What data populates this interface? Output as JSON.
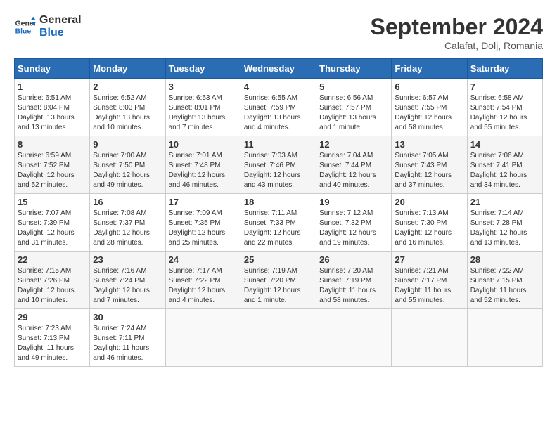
{
  "header": {
    "logo_line1": "General",
    "logo_line2": "Blue",
    "month_title": "September 2024",
    "subtitle": "Calafat, Dolj, Romania"
  },
  "weekdays": [
    "Sunday",
    "Monday",
    "Tuesday",
    "Wednesday",
    "Thursday",
    "Friday",
    "Saturday"
  ],
  "weeks": [
    [
      {
        "day": "1",
        "info": "Sunrise: 6:51 AM\nSunset: 8:04 PM\nDaylight: 13 hours\nand 13 minutes."
      },
      {
        "day": "2",
        "info": "Sunrise: 6:52 AM\nSunset: 8:03 PM\nDaylight: 13 hours\nand 10 minutes."
      },
      {
        "day": "3",
        "info": "Sunrise: 6:53 AM\nSunset: 8:01 PM\nDaylight: 13 hours\nand 7 minutes."
      },
      {
        "day": "4",
        "info": "Sunrise: 6:55 AM\nSunset: 7:59 PM\nDaylight: 13 hours\nand 4 minutes."
      },
      {
        "day": "5",
        "info": "Sunrise: 6:56 AM\nSunset: 7:57 PM\nDaylight: 13 hours\nand 1 minute."
      },
      {
        "day": "6",
        "info": "Sunrise: 6:57 AM\nSunset: 7:55 PM\nDaylight: 12 hours\nand 58 minutes."
      },
      {
        "day": "7",
        "info": "Sunrise: 6:58 AM\nSunset: 7:54 PM\nDaylight: 12 hours\nand 55 minutes."
      }
    ],
    [
      {
        "day": "8",
        "info": "Sunrise: 6:59 AM\nSunset: 7:52 PM\nDaylight: 12 hours\nand 52 minutes."
      },
      {
        "day": "9",
        "info": "Sunrise: 7:00 AM\nSunset: 7:50 PM\nDaylight: 12 hours\nand 49 minutes."
      },
      {
        "day": "10",
        "info": "Sunrise: 7:01 AM\nSunset: 7:48 PM\nDaylight: 12 hours\nand 46 minutes."
      },
      {
        "day": "11",
        "info": "Sunrise: 7:03 AM\nSunset: 7:46 PM\nDaylight: 12 hours\nand 43 minutes."
      },
      {
        "day": "12",
        "info": "Sunrise: 7:04 AM\nSunset: 7:44 PM\nDaylight: 12 hours\nand 40 minutes."
      },
      {
        "day": "13",
        "info": "Sunrise: 7:05 AM\nSunset: 7:43 PM\nDaylight: 12 hours\nand 37 minutes."
      },
      {
        "day": "14",
        "info": "Sunrise: 7:06 AM\nSunset: 7:41 PM\nDaylight: 12 hours\nand 34 minutes."
      }
    ],
    [
      {
        "day": "15",
        "info": "Sunrise: 7:07 AM\nSunset: 7:39 PM\nDaylight: 12 hours\nand 31 minutes."
      },
      {
        "day": "16",
        "info": "Sunrise: 7:08 AM\nSunset: 7:37 PM\nDaylight: 12 hours\nand 28 minutes."
      },
      {
        "day": "17",
        "info": "Sunrise: 7:09 AM\nSunset: 7:35 PM\nDaylight: 12 hours\nand 25 minutes."
      },
      {
        "day": "18",
        "info": "Sunrise: 7:11 AM\nSunset: 7:33 PM\nDaylight: 12 hours\nand 22 minutes."
      },
      {
        "day": "19",
        "info": "Sunrise: 7:12 AM\nSunset: 7:32 PM\nDaylight: 12 hours\nand 19 minutes."
      },
      {
        "day": "20",
        "info": "Sunrise: 7:13 AM\nSunset: 7:30 PM\nDaylight: 12 hours\nand 16 minutes."
      },
      {
        "day": "21",
        "info": "Sunrise: 7:14 AM\nSunset: 7:28 PM\nDaylight: 12 hours\nand 13 minutes."
      }
    ],
    [
      {
        "day": "22",
        "info": "Sunrise: 7:15 AM\nSunset: 7:26 PM\nDaylight: 12 hours\nand 10 minutes."
      },
      {
        "day": "23",
        "info": "Sunrise: 7:16 AM\nSunset: 7:24 PM\nDaylight: 12 hours\nand 7 minutes."
      },
      {
        "day": "24",
        "info": "Sunrise: 7:17 AM\nSunset: 7:22 PM\nDaylight: 12 hours\nand 4 minutes."
      },
      {
        "day": "25",
        "info": "Sunrise: 7:19 AM\nSunset: 7:20 PM\nDaylight: 12 hours\nand 1 minute."
      },
      {
        "day": "26",
        "info": "Sunrise: 7:20 AM\nSunset: 7:19 PM\nDaylight: 11 hours\nand 58 minutes."
      },
      {
        "day": "27",
        "info": "Sunrise: 7:21 AM\nSunset: 7:17 PM\nDaylight: 11 hours\nand 55 minutes."
      },
      {
        "day": "28",
        "info": "Sunrise: 7:22 AM\nSunset: 7:15 PM\nDaylight: 11 hours\nand 52 minutes."
      }
    ],
    [
      {
        "day": "29",
        "info": "Sunrise: 7:23 AM\nSunset: 7:13 PM\nDaylight: 11 hours\nand 49 minutes."
      },
      {
        "day": "30",
        "info": "Sunrise: 7:24 AM\nSunset: 7:11 PM\nDaylight: 11 hours\nand 46 minutes."
      },
      {
        "day": "",
        "info": ""
      },
      {
        "day": "",
        "info": ""
      },
      {
        "day": "",
        "info": ""
      },
      {
        "day": "",
        "info": ""
      },
      {
        "day": "",
        "info": ""
      }
    ]
  ]
}
